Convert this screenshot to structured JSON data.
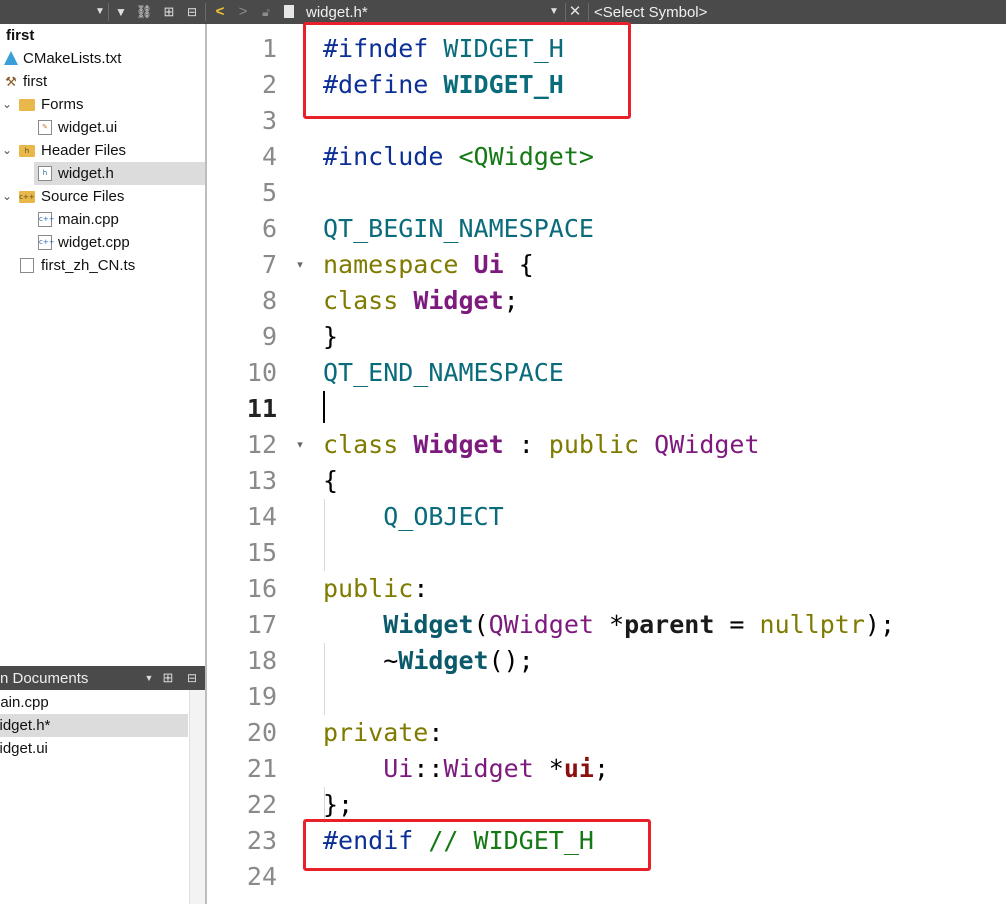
{
  "toolbar": {
    "file_tab": "widget.h*",
    "symbol_selector": "<Select Symbol>"
  },
  "project_tree": {
    "items": [
      {
        "label": "first",
        "bold": true
      },
      {
        "label": "CMakeLists.txt"
      },
      {
        "label": "first"
      },
      {
        "label": "Forms"
      },
      {
        "label": "widget.ui"
      },
      {
        "label": "Header Files"
      },
      {
        "label": "widget.h",
        "selected": true
      },
      {
        "label": "Source Files"
      },
      {
        "label": "main.cpp"
      },
      {
        "label": "widget.cpp"
      },
      {
        "label": "first_zh_CN.ts"
      }
    ]
  },
  "open_documents": {
    "title": "n Documents",
    "items": [
      {
        "label": "nain.cpp"
      },
      {
        "label": "vidget.h*",
        "selected": true
      },
      {
        "label": "vidget.ui"
      }
    ]
  },
  "editor": {
    "current_line": "11",
    "line_numbers": [
      "1",
      "2",
      "3",
      "4",
      "5",
      "6",
      "7",
      "8",
      "9",
      "10",
      "11",
      "12",
      "13",
      "14",
      "15",
      "16",
      "17",
      "18",
      "19",
      "20",
      "21",
      "22",
      "23",
      "24"
    ],
    "code": {
      "l1": [
        "#ifndef",
        " ",
        "WIDGET_H"
      ],
      "l2": [
        "#define",
        " ",
        "WIDGET_H"
      ],
      "l4": [
        "#include",
        " ",
        "<QWidget>"
      ],
      "l6": [
        "QT_BEGIN_NAMESPACE"
      ],
      "l7": [
        "namespace",
        " ",
        "Ui",
        " {"
      ],
      "l8": [
        "class",
        " ",
        "Widget",
        ";"
      ],
      "l9": [
        "}"
      ],
      "l10": [
        "QT_END_NAMESPACE"
      ],
      "l12": [
        "class",
        " ",
        "Widget",
        " : ",
        "public",
        " ",
        "QWidget"
      ],
      "l13": [
        "{"
      ],
      "l14": [
        "    ",
        "Q_OBJECT"
      ],
      "l16": [
        "public",
        ":"
      ],
      "l17": [
        "    ",
        "Widget",
        "(",
        "QWidget",
        " *",
        "parent",
        " = ",
        "nullptr",
        ");"
      ],
      "l18": [
        "    ~",
        "Widget",
        "();"
      ],
      "l20": [
        "private",
        ":"
      ],
      "l21": [
        "    ",
        "Ui",
        "::",
        "Widget",
        " *",
        "ui",
        ";"
      ],
      "l22": [
        "};"
      ],
      "l23": [
        "#endif",
        " ",
        "// WIDGET_H"
      ]
    }
  },
  "colors": {
    "highlight_box": "#e8202a",
    "toolbar_bg": "#4a4a4a",
    "selection_bg": "#dcdcdc"
  }
}
